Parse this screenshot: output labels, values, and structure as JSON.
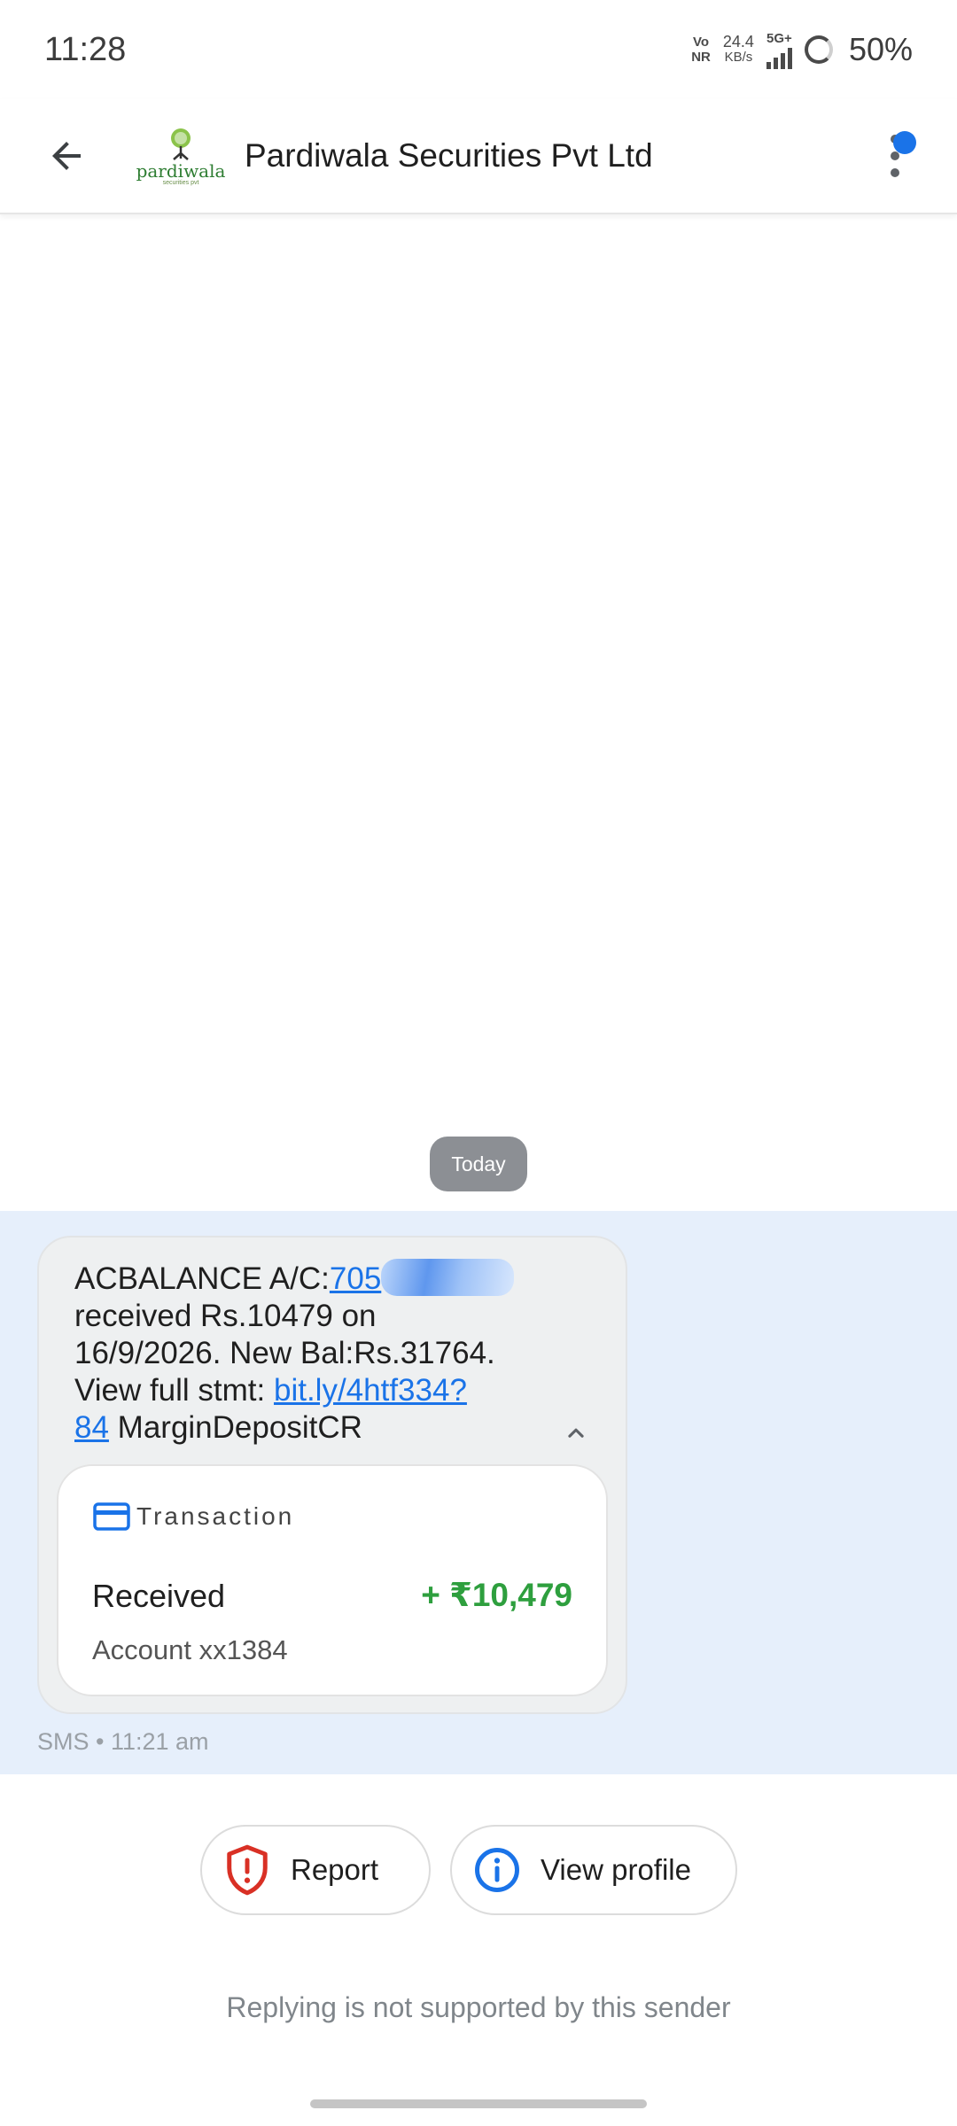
{
  "status_bar": {
    "time": "11:28",
    "network_top": "Vo",
    "network_bottom": "NR",
    "speed_value": "24.4",
    "speed_unit": "KB/s",
    "signal_type": "5G+",
    "battery": "50%"
  },
  "header": {
    "avatar_brand": "pardiwala",
    "avatar_sub": "securities pvt",
    "sender_name": "Pardiwala Securities Pvt Ltd"
  },
  "thread": {
    "date_chip": "Today"
  },
  "message": {
    "line1_prefix": "ACBALANCE A/C:",
    "account_partial": "705",
    "line2": "received Rs.10479 on",
    "line3": "16/9/2026. New Bal:Rs.31764.",
    "line4_prefix": "View full stmt: ",
    "link_part1": "bit.ly/4htf334?",
    "link_part2": "84",
    "line5_suffix": " MarginDepositCR",
    "meta": "SMS • 11:21 am"
  },
  "transaction": {
    "heading": "Transaction",
    "type": "Received",
    "amount": "+ ₹10,479",
    "account": "Account xx1384",
    "amount_color": "#2e9f3e"
  },
  "actions": {
    "report_label": "Report",
    "profile_label": "View profile"
  },
  "footer": {
    "reply_note": "Replying is not supported by this sender"
  },
  "colors": {
    "accent": "#1a73e8",
    "selection_bg": "#e6effb",
    "report_red": "#d93025"
  }
}
